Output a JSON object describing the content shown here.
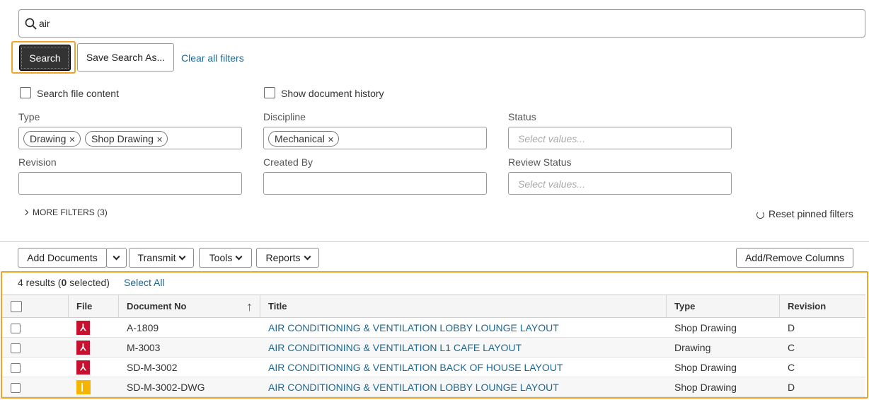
{
  "search": {
    "value": "air",
    "search_label": "Search",
    "save_label": "Save Search As...",
    "clear_label": "Clear all filters"
  },
  "options": {
    "search_file_content": "Search file content",
    "show_history": "Show document history"
  },
  "filters": {
    "type": {
      "label": "Type",
      "chips": [
        "Drawing",
        "Shop Drawing"
      ]
    },
    "discipline": {
      "label": "Discipline",
      "chips": [
        "Mechanical"
      ]
    },
    "status": {
      "label": "Status",
      "placeholder": "Select values..."
    },
    "revision": {
      "label": "Revision"
    },
    "created_by": {
      "label": "Created By"
    },
    "review_status": {
      "label": "Review Status",
      "placeholder": "Select values..."
    },
    "more_filters": "MORE FILTERS (3)",
    "reset_pinned": "Reset pinned filters"
  },
  "toolbar": {
    "add_documents": "Add Documents",
    "transmit": "Transmit",
    "tools": "Tools",
    "reports": "Reports",
    "add_remove_columns": "Add/Remove Columns"
  },
  "results": {
    "count_prefix": "4 results (",
    "selected_count": "0",
    "count_suffix": " selected)",
    "select_all": "Select All"
  },
  "table": {
    "headers": {
      "file": "File",
      "document_no": "Document No",
      "title": "Title",
      "type": "Type",
      "revision": "Revision"
    },
    "rows": [
      {
        "file_icon": "pdf-icon",
        "document_no": "A-1809",
        "title": "AIR CONDITIONING & VENTILATION LOBBY LOUNGE LAYOUT",
        "type": "Shop Drawing",
        "revision": "D"
      },
      {
        "file_icon": "pdf-icon",
        "document_no": "M-3003",
        "title": "AIR CONDITIONING & VENTILATION L1 CAFE LAYOUT",
        "type": "Drawing",
        "revision": "C"
      },
      {
        "file_icon": "pdf-icon",
        "document_no": "SD-M-3002",
        "title": "AIR CONDITIONING & VENTILATION BACK OF HOUSE LAYOUT",
        "type": "Shop Drawing",
        "revision": "C"
      },
      {
        "file_icon": "dwg-icon",
        "document_no": "SD-M-3002-DWG",
        "title": "AIR CONDITIONING & VENTILATION LOBBY LOUNGE LAYOUT",
        "type": "Shop Drawing",
        "revision": "D"
      }
    ]
  },
  "colors": {
    "accent_highlight": "#f0a52a",
    "link": "#1d6791",
    "pdf": "#c8102e",
    "dwg": "#f4b400",
    "primary_button": "#333333"
  }
}
